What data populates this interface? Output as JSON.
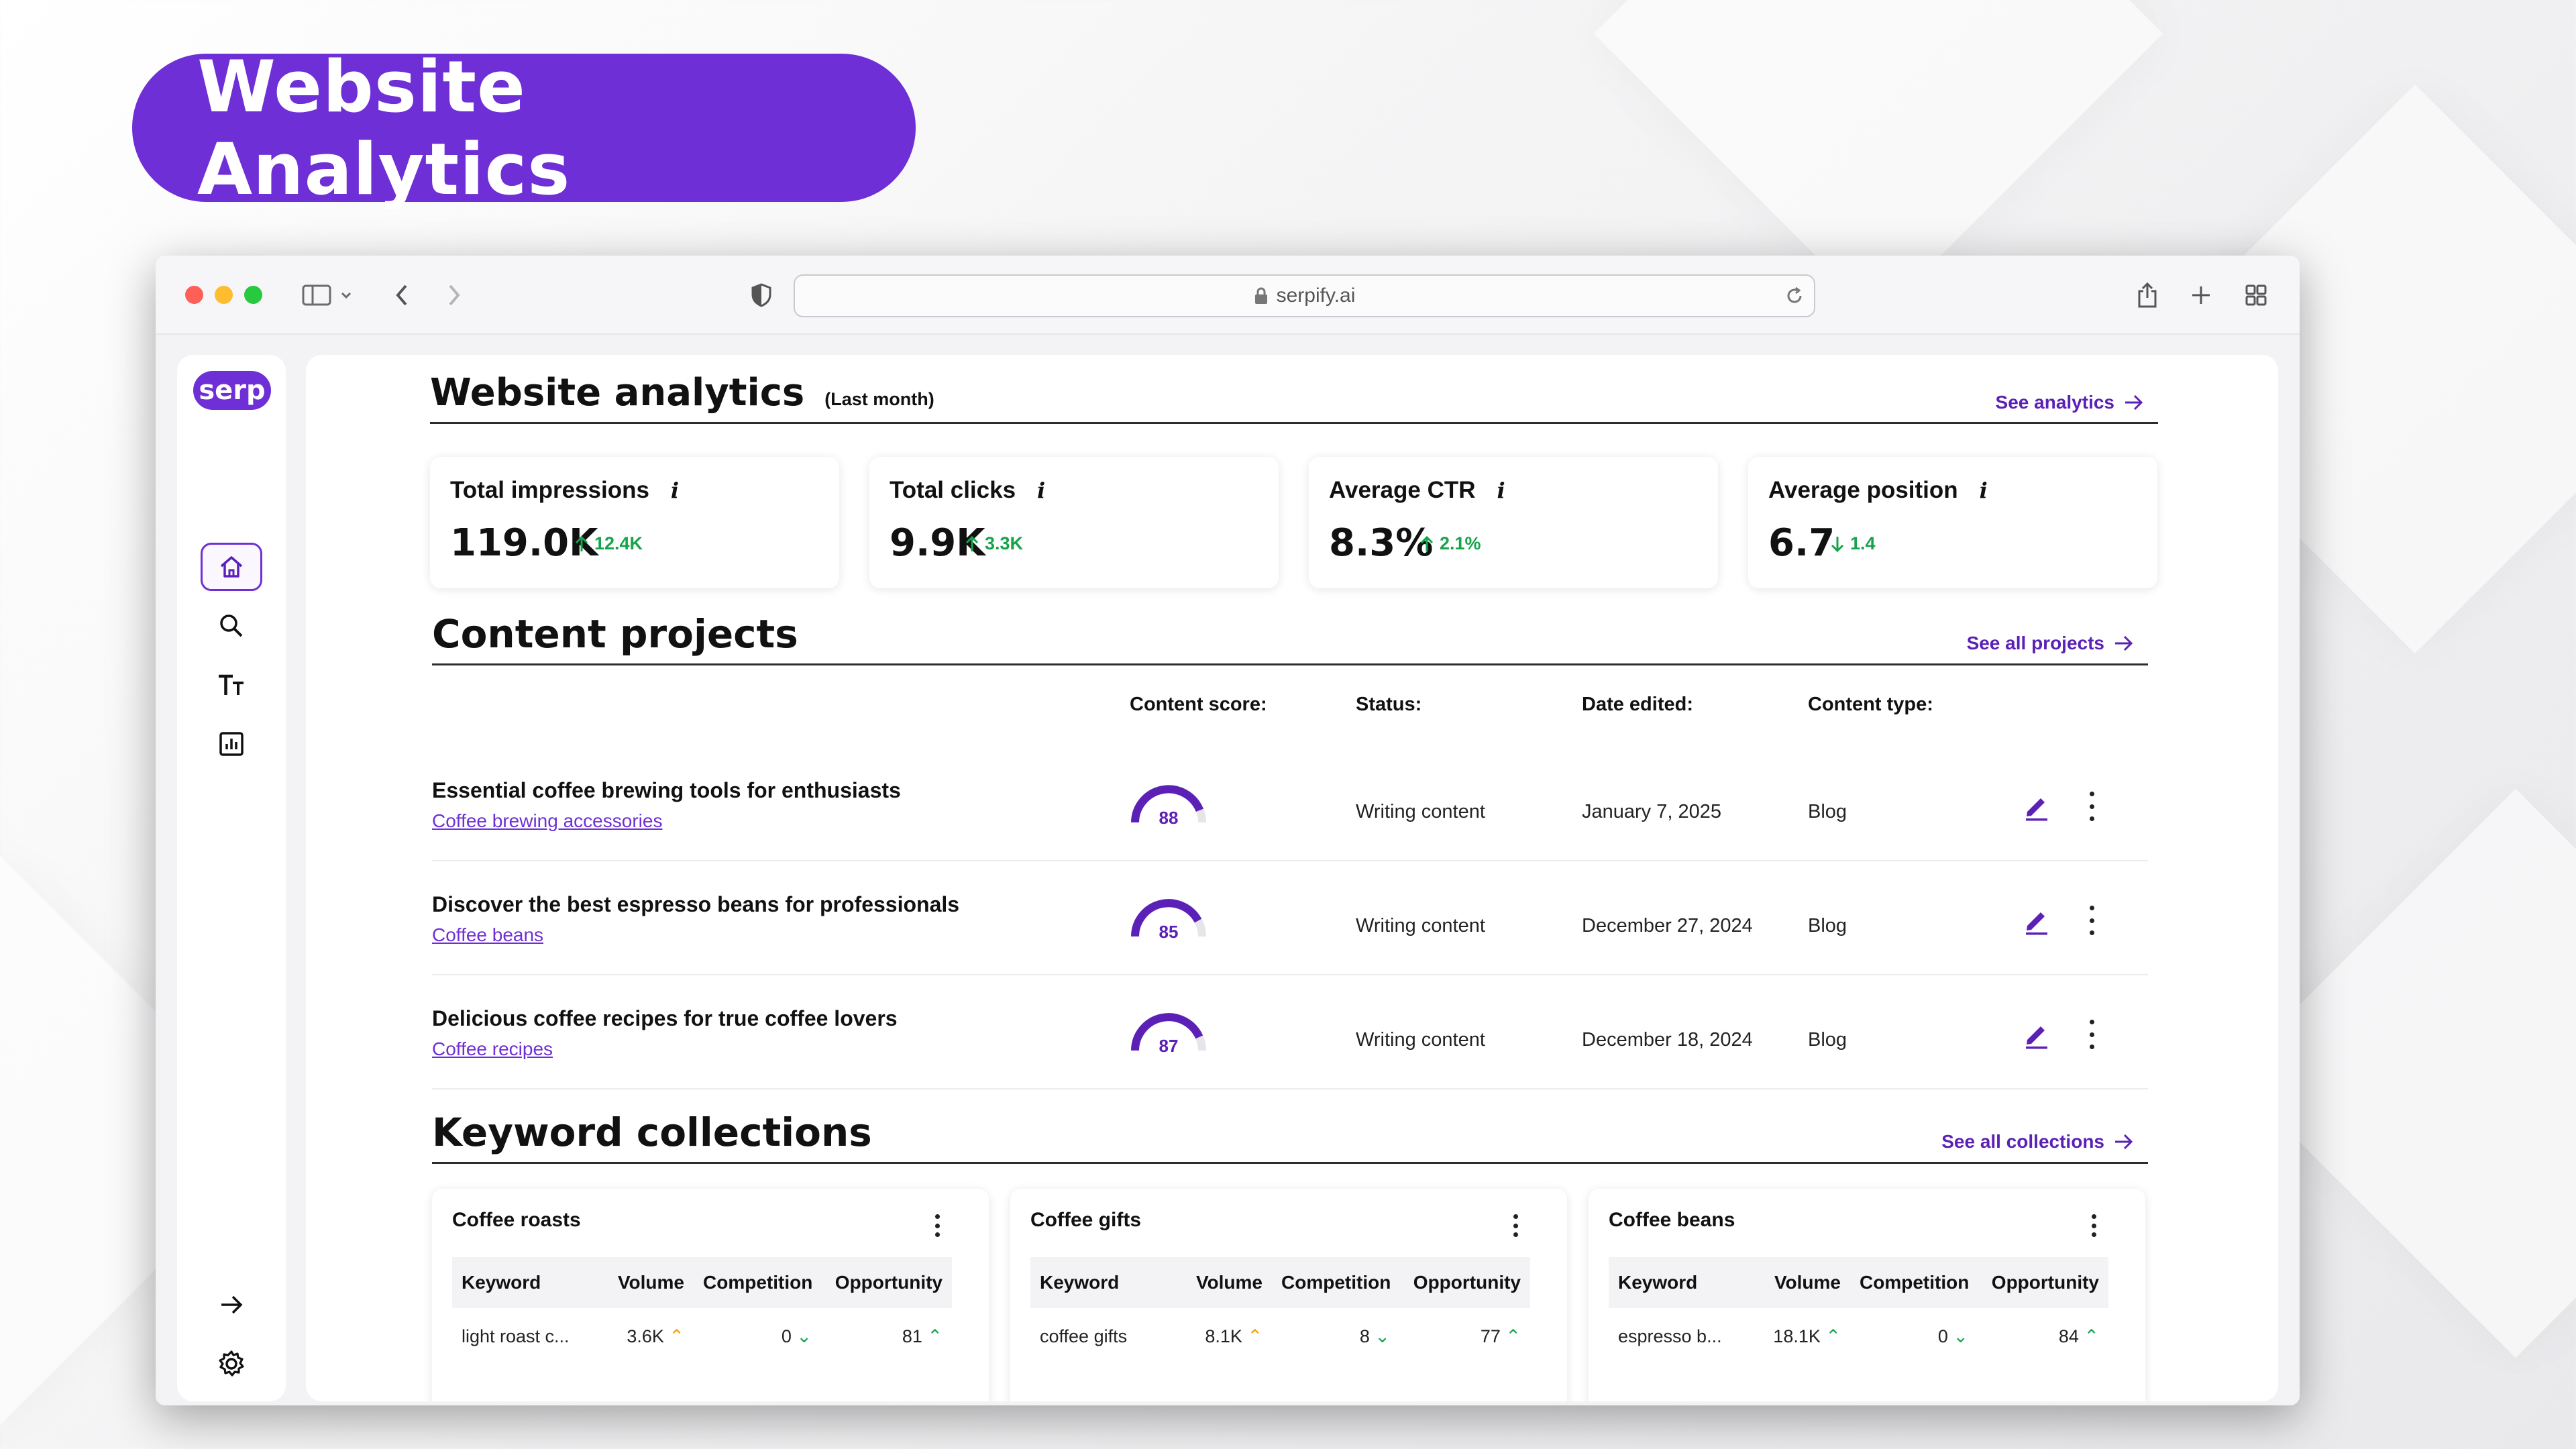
{
  "banner": {
    "title": "Website Analytics"
  },
  "browser": {
    "url": "serpify.ai"
  },
  "sidebar": {
    "logo": "serp"
  },
  "analytics": {
    "title": "Website analytics",
    "subtitle": "(Last month)",
    "link": "See analytics",
    "cards": [
      {
        "label": "Total impressions",
        "value": "119.0K",
        "delta": "12.4K",
        "direction": "up"
      },
      {
        "label": "Total clicks",
        "value": "9.9K",
        "delta": "3.3K",
        "direction": "up"
      },
      {
        "label": "Average CTR",
        "value": "8.3%",
        "delta": "2.1%",
        "direction": "up"
      },
      {
        "label": "Average position",
        "value": "6.7",
        "delta": "1.4",
        "direction": "down"
      }
    ],
    "info_glyph": "i"
  },
  "projects": {
    "title": "Content projects",
    "link": "See all projects",
    "columns": {
      "score": "Content score:",
      "status": "Status:",
      "date": "Date edited:",
      "type": "Content type:"
    },
    "rows": [
      {
        "title": "Essential coffee brewing tools for enthusiasts",
        "link": "Coffee brewing accessories",
        "score": "88",
        "status": "Writing content",
        "date": "January 7, 2025",
        "type": "Blog"
      },
      {
        "title": "Discover the best espresso beans for professionals",
        "link": "Coffee beans",
        "score": "85",
        "status": "Writing content",
        "date": "December 27, 2024",
        "type": "Blog"
      },
      {
        "title": "Delicious coffee recipes for true coffee lovers",
        "link": "Coffee recipes",
        "score": "87",
        "status": "Writing content",
        "date": "December 18, 2024",
        "type": "Blog"
      }
    ]
  },
  "collections": {
    "title": "Keyword collections",
    "link": "See all collections",
    "headers": {
      "keyword": "Keyword",
      "volume": "Volume",
      "competition": "Competition",
      "opportunity": "Opportunity"
    },
    "cards": [
      {
        "name": "Coffee roasts",
        "keyword": "light roast c...",
        "volume": "3.6K",
        "competition": "0",
        "opportunity": "81"
      },
      {
        "name": "Coffee gifts",
        "keyword": "coffee gifts",
        "volume": "8.1K",
        "competition": "8",
        "opportunity": "77"
      },
      {
        "name": "Coffee beans",
        "keyword": "espresso b...",
        "volume": "18.1K",
        "competition": "0",
        "opportunity": "84"
      }
    ]
  },
  "help": {
    "glyph": "?"
  },
  "colors": {
    "accent": "#6e2fd6",
    "positive": "#16a34a",
    "warning": "#f59e0b"
  }
}
